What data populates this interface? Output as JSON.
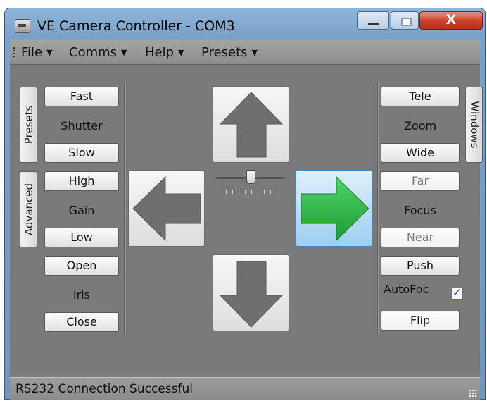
{
  "window": {
    "title": "VE Camera Controller - COM3",
    "close_glyph": "X"
  },
  "menu": [
    {
      "label": "File",
      "arrow": "▼"
    },
    {
      "label": "Comms",
      "arrow": "▼"
    },
    {
      "label": "Help",
      "arrow": "▼"
    },
    {
      "label": "Presets",
      "arrow": "▼"
    }
  ],
  "tabs": {
    "presets": "Presets",
    "advanced": "Advanced",
    "windows": "Windows"
  },
  "shutter": {
    "fast": "Fast",
    "label": "Shutter",
    "slow": "Slow"
  },
  "gain": {
    "high": "High",
    "label": "Gain",
    "low": "Low"
  },
  "iris": {
    "open": "Open",
    "label": "Iris",
    "close": "Close"
  },
  "zoom": {
    "tele": "Tele",
    "label": "Zoom",
    "wide": "Wide"
  },
  "focus": {
    "far": "Far",
    "label": "Focus",
    "near": "Near",
    "push": "Push",
    "autofocus_label": "AutoFoc",
    "autofocus_checked": true
  },
  "flip": "Flip",
  "speed_slider": {
    "value": 0.5
  },
  "active_direction": "right",
  "colors": {
    "active_arrow": "#2eaa3f",
    "inactive_arrow": "#6f6f6f",
    "close_button": "#c9402a"
  },
  "status": {
    "text": "RS232 Connection Successful"
  }
}
